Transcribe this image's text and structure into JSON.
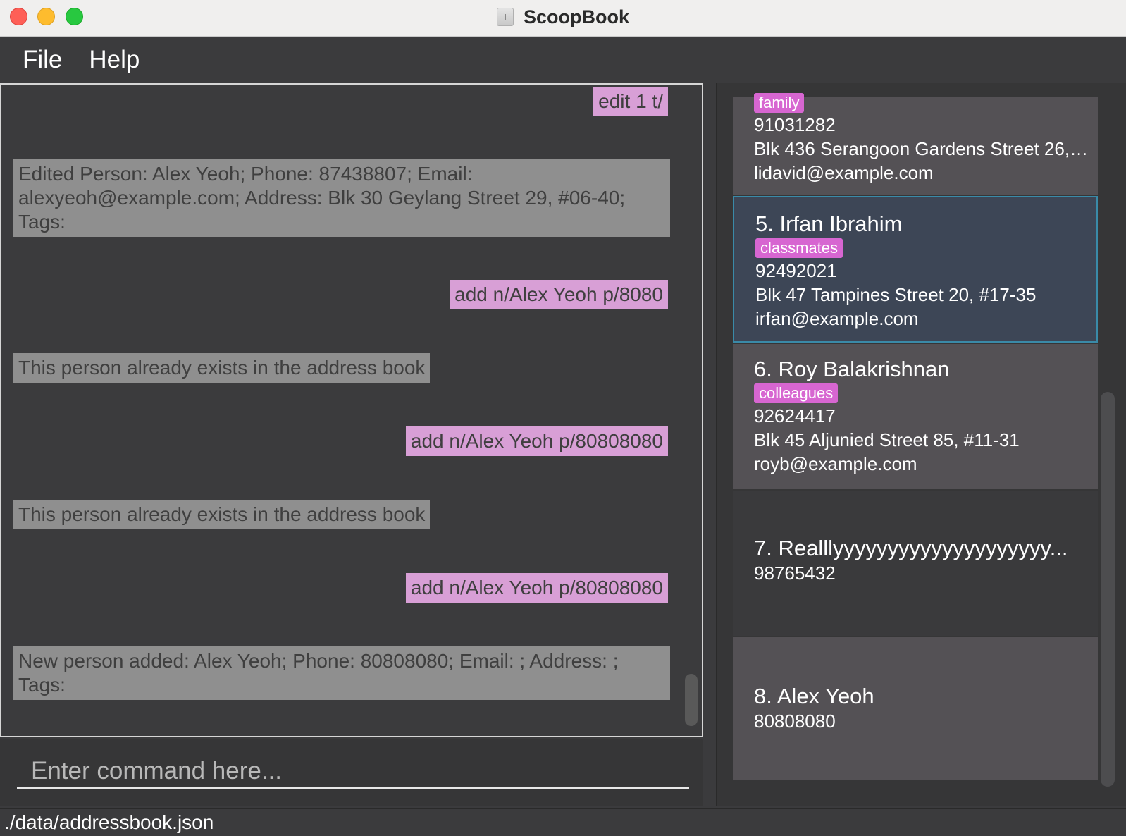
{
  "window": {
    "title": "ScoopBook"
  },
  "menu": {
    "file": "File",
    "help": "Help"
  },
  "result_panel": {
    "messages": [
      {
        "type": "command",
        "text": "edit 1 t/"
      },
      {
        "type": "response",
        "text": "Edited Person: Alex Yeoh; Phone: 87438807; Email: alexyeoh@example.com; Address: Blk 30 Geylang Street 29, #06-40; Tags:"
      },
      {
        "type": "command",
        "text": "add n/Alex Yeoh p/8080"
      },
      {
        "type": "response",
        "text": "This person already exists in the address book"
      },
      {
        "type": "command",
        "text": "add n/Alex Yeoh p/80808080"
      },
      {
        "type": "response",
        "text": "This person already exists in the address book"
      },
      {
        "type": "command",
        "text": "add n/Alex  Yeoh p/80808080"
      },
      {
        "type": "response",
        "text": "New person added: Alex  Yeoh; Phone: 80808080; Email: ; Address: ; Tags:"
      }
    ]
  },
  "command_box": {
    "placeholder": "Enter command here..."
  },
  "person_list": {
    "cards": [
      {
        "name": "",
        "tag": "family",
        "phone": "91031282",
        "address": "Blk 436 Serangoon Gardens Street 26, #1...",
        "email": "lidavid@example.com"
      },
      {
        "name": "5. Irfan Ibrahim",
        "tag": "classmates",
        "phone": "92492021",
        "address": "Blk 47 Tampines Street 20, #17-35",
        "email": "irfan@example.com"
      },
      {
        "name": "6. Roy Balakrishnan",
        "tag": "colleagues",
        "phone": "92624417",
        "address": "Blk 45 Aljunied Street 85, #11-31",
        "email": "royb@example.com"
      },
      {
        "name": "7. Realllyyyyyyyyyyyyyyyyyyyy...",
        "phone": "98765432"
      },
      {
        "name": "8. Alex  Yeoh",
        "phone": "80808080"
      }
    ]
  },
  "status_bar": {
    "path": "./data/addressbook.json"
  },
  "colors": {
    "command_bubble": "#d89fd6",
    "response_bubble": "#8f8f8f",
    "tag": "#d766d1",
    "selected_card_border": "#3a8aa8"
  }
}
